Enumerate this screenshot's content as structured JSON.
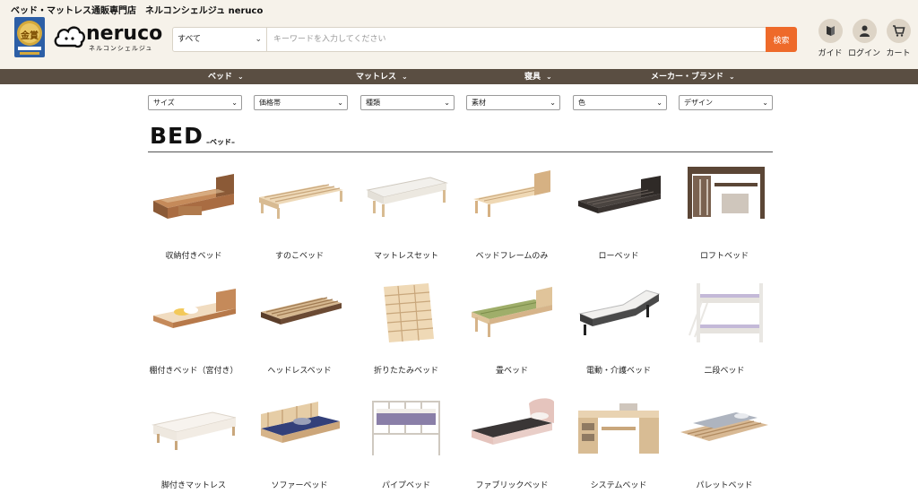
{
  "header": {
    "tagline": "ベッド・マットレス通販専門店　ネルコンシェルジュ neruco",
    "award_text": "金賞",
    "logo_word": "neruco",
    "logo_sub": "ネルコンシェルジュ"
  },
  "search": {
    "category": "すべて",
    "placeholder": "キーワードを入力してください",
    "value": "",
    "button_label": "検索"
  },
  "header_icons": [
    {
      "label": "ガイド",
      "icon": "guide-icon"
    },
    {
      "label": "ログイン",
      "icon": "user-icon"
    },
    {
      "label": "カート",
      "icon": "cart-icon"
    }
  ],
  "nav": [
    {
      "label": "ベッド"
    },
    {
      "label": "マットレス"
    },
    {
      "label": "寝具"
    },
    {
      "label": "メーカー・ブランド"
    }
  ],
  "filters": [
    {
      "label": "サイズ"
    },
    {
      "label": "価格帯"
    },
    {
      "label": "種類"
    },
    {
      "label": "素材"
    },
    {
      "label": "色"
    },
    {
      "label": "デザイン"
    }
  ],
  "section": {
    "title": "BED",
    "subtitle": "–ベッド–"
  },
  "products": [
    {
      "name": "収納付きベッド",
      "icon": "storage-bed-icon"
    },
    {
      "name": "すのこベッド",
      "icon": "slatted-bed-icon"
    },
    {
      "name": "マットレスセット",
      "icon": "mattress-set-icon"
    },
    {
      "name": "ベッドフレームのみ",
      "icon": "bed-frame-icon"
    },
    {
      "name": "ローベッド",
      "icon": "low-bed-icon"
    },
    {
      "name": "ロフトベッド",
      "icon": "loft-bed-icon"
    },
    {
      "name": "棚付きベッド（宮付き）",
      "icon": "shelf-bed-icon"
    },
    {
      "name": "ヘッドレスベッド",
      "icon": "headless-bed-icon"
    },
    {
      "name": "折りたたみベッド",
      "icon": "folding-bed-icon"
    },
    {
      "name": "畳ベッド",
      "icon": "tatami-bed-icon"
    },
    {
      "name": "電動・介護ベッド",
      "icon": "electric-bed-icon"
    },
    {
      "name": "二段ベッド",
      "icon": "bunk-bed-icon"
    },
    {
      "name": "脚付きマットレス",
      "icon": "legged-mattress-icon"
    },
    {
      "name": "ソファーベッド",
      "icon": "sofa-bed-icon"
    },
    {
      "name": "パイプベッド",
      "icon": "pipe-bed-icon"
    },
    {
      "name": "ファブリックベッド",
      "icon": "fabric-bed-icon"
    },
    {
      "name": "システムベッド",
      "icon": "system-bed-icon"
    },
    {
      "name": "パレットベッド",
      "icon": "pallet-bed-icon"
    }
  ],
  "colors": {
    "header_bg": "#f6f2ea",
    "nav_bg": "#5a4e42",
    "accent": "#ee6a2a"
  }
}
